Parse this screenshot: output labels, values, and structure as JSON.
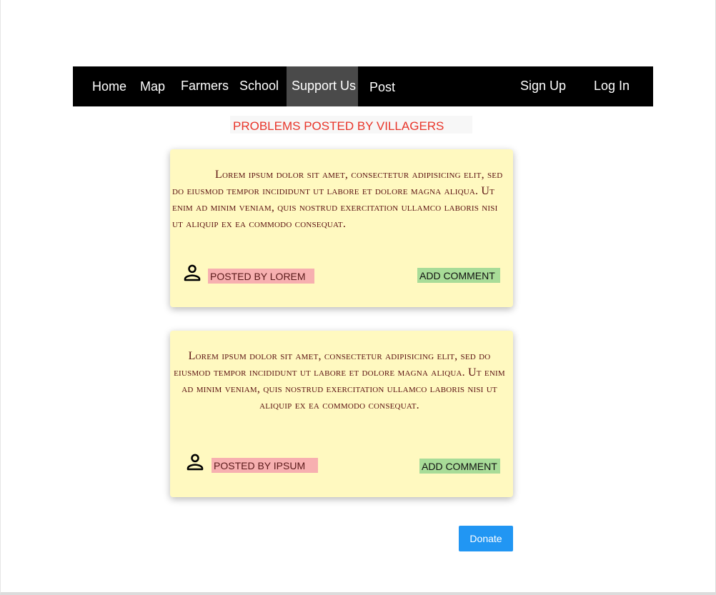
{
  "nav": {
    "home": "Home",
    "map": "Map",
    "farmers": "Farmers",
    "school": "School",
    "support_us": "Support Us",
    "post": "Post",
    "sign_up": "Sign Up",
    "log_in": "Log In",
    "active_item": "Support Us"
  },
  "page": {
    "title": "PROBLEMS POSTED BY VILLAGERS"
  },
  "posts": [
    {
      "text": "Lorem ipsum dolor sit amet, consectetur adipisicing elit, sed do eiusmod tempor incididunt ut labore et dolore magna aliqua. Ut enim ad minim veniam, quis nostrud exercitation ullamco laboris nisi ut aliquip ex ea commodo consequat.",
      "author_icon": "person-icon",
      "posted_by": "POSTED BY LOREM",
      "comment_label": "ADD COMMENT"
    },
    {
      "text": "Lorem ipsum dolor sit amet, consectetur adipisicing elit, sed do eiusmod tempor incididunt ut labore et dolore magna aliqua. Ut enim ad minim veniam, quis nostrud exercitation ullamco laboris nisi ut aliquip ex ea commodo consequat.",
      "author_icon": "person-icon",
      "posted_by": "POSTED BY IPSUM",
      "comment_label": "ADD COMMENT"
    }
  ],
  "donate": {
    "label": "Donate"
  },
  "colors": {
    "navbar_bg": "#000000",
    "nav_active_bg": "#4a4a4a",
    "title_text": "#e8352a",
    "card_bg": "#fff9c0",
    "card_text": "#5a1010",
    "posted_by_bg": "#f7b0b0",
    "add_comment_bg": "#a8dc98",
    "donate_bg": "#2196f3"
  }
}
